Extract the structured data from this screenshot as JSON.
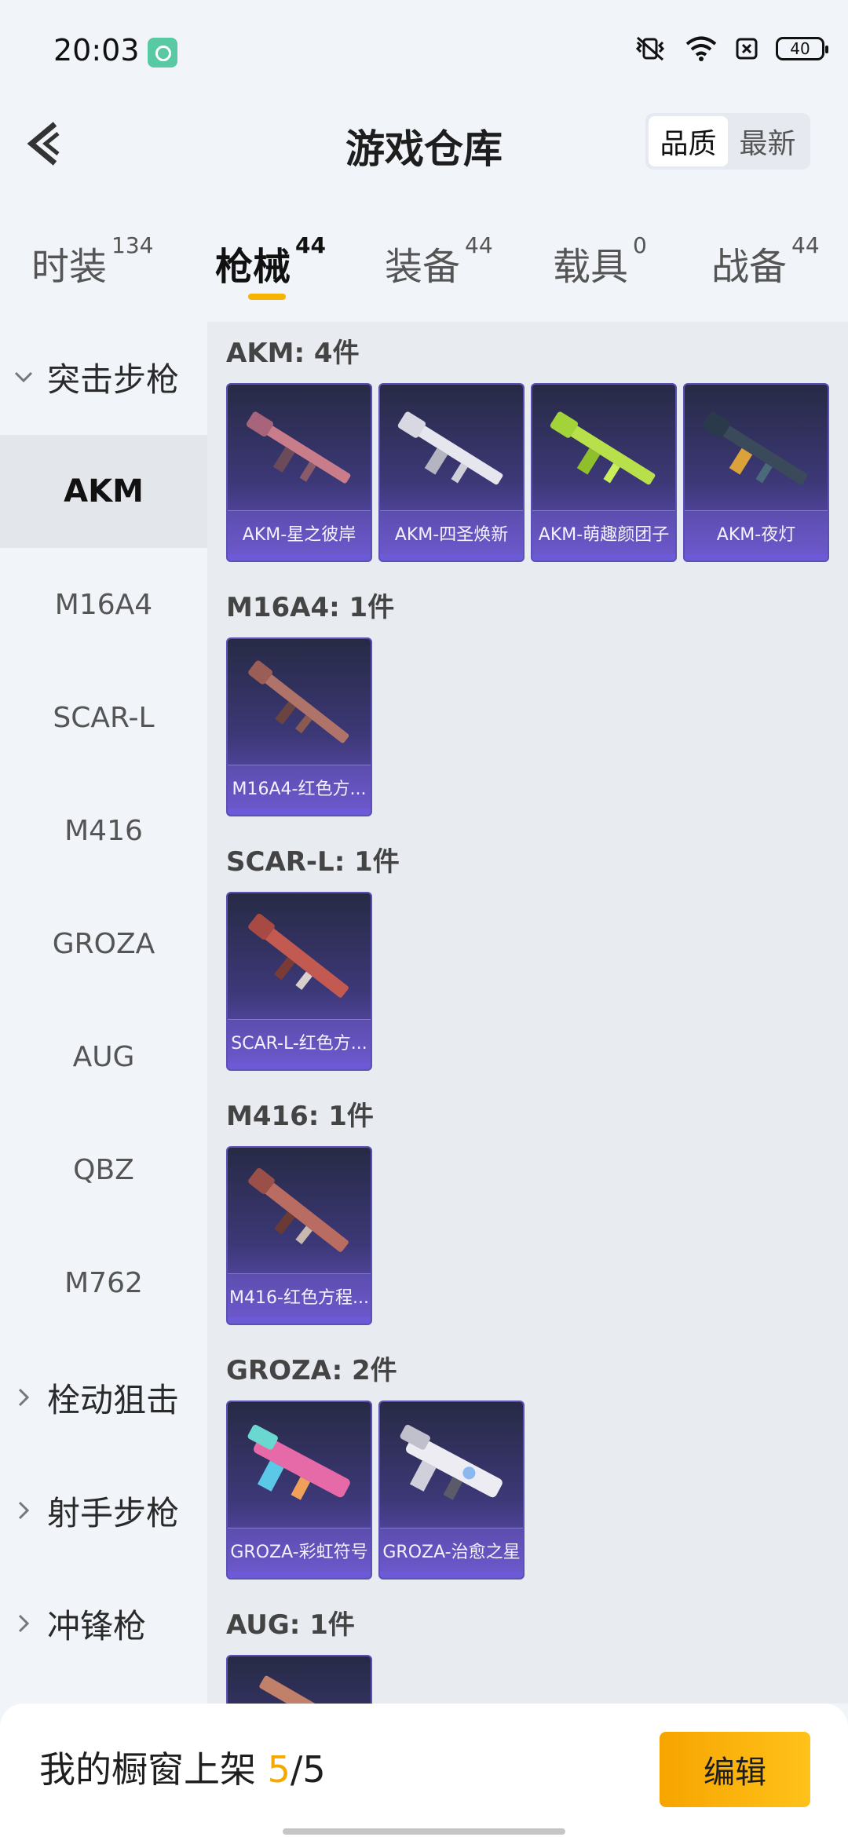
{
  "status_bar": {
    "time": "20:03",
    "battery": "40"
  },
  "header": {
    "title": "游戏仓库",
    "sort_options": [
      "品质",
      "最新"
    ],
    "active_sort": "品质"
  },
  "tabs": [
    {
      "label": "时装",
      "count": "134"
    },
    {
      "label": "枪械",
      "count": "44"
    },
    {
      "label": "装备",
      "count": "44"
    },
    {
      "label": "载具",
      "count": "0"
    },
    {
      "label": "战备",
      "count": "44"
    }
  ],
  "active_tab": "枪械",
  "sidebar": {
    "group_assault": "突击步枪",
    "items": [
      "AKM",
      "M16A4",
      "SCAR-L",
      "M416",
      "GROZA",
      "AUG",
      "QBZ",
      "M762"
    ],
    "active_item": "AKM",
    "group_bolt": "栓动狙击",
    "group_marksman": "射手步枪",
    "group_smg": "冲锋枪"
  },
  "sections": [
    {
      "title": "AKM: 4件",
      "items": [
        "AKM-星之彼岸",
        "AKM-四圣焕新",
        "AKM-萌趣颜团子",
        "AKM-夜灯"
      ]
    },
    {
      "title": "M16A4: 1件",
      "items": [
        "M16A4-红色方..."
      ]
    },
    {
      "title": "SCAR-L: 1件",
      "items": [
        "SCAR-L-红色方..."
      ]
    },
    {
      "title": "M416: 1件",
      "items": [
        "M416-红色方程..."
      ]
    },
    {
      "title": "GROZA: 2件",
      "items": [
        "GROZA-彩虹符号",
        "GROZA-治愈之星"
      ]
    },
    {
      "title": "AUG: 1件",
      "items": [
        ""
      ]
    }
  ],
  "bottom_bar": {
    "shelf_label": "我的橱窗上架",
    "shelf_current": "5",
    "shelf_sep": "/",
    "shelf_total": "5",
    "edit_label": "编辑"
  },
  "colors": {
    "accent": "#f5b400",
    "card_bg": "#3c3877"
  }
}
